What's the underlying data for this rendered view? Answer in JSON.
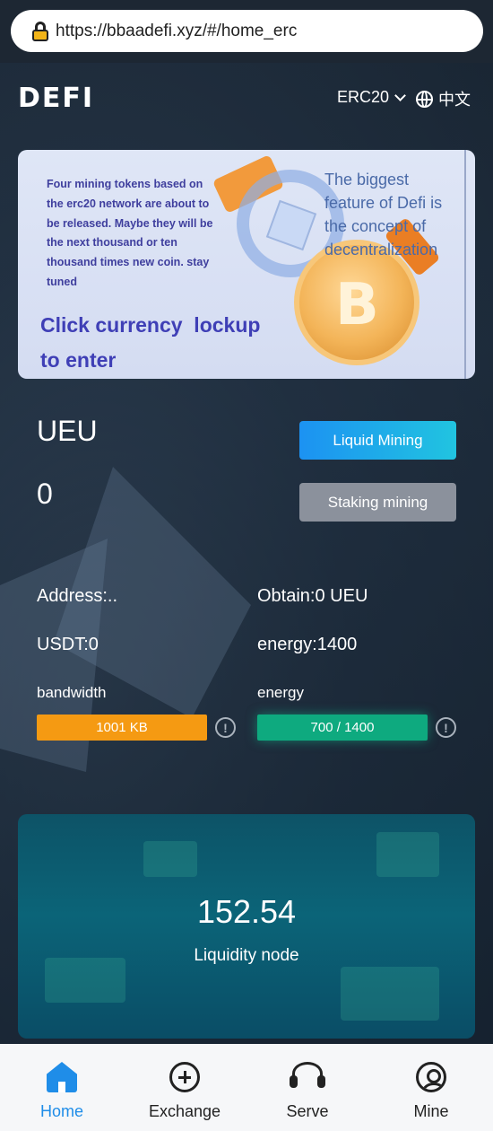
{
  "browser": {
    "url": "https://bbaadefi.xyz/#/home_erc"
  },
  "header": {
    "logo": "DEFI",
    "network": "ERC20",
    "language": "中文"
  },
  "banner": {
    "text": "Four mining tokens based on the erc20 network are about to be released. Maybe they will be the next thousand or ten thousand times new coin. stay tuned",
    "cta_line1": "Click currency  lockup",
    "cta_line2": "to enter",
    "tagline": "The biggest feature of Defi is the concept of decentralization"
  },
  "token": {
    "name": "UEU",
    "amount": "0",
    "liquid_button": "Liquid Mining",
    "staking_button": "Staking mining"
  },
  "account": {
    "address": "Address:..",
    "obtain": "Obtain:0 UEU",
    "usdt": "USDT:0",
    "energy": "energy:1400",
    "bandwidth_label": "bandwidth",
    "energy_label": "energy",
    "bandwidth_bar": "1001 KB",
    "energy_bar": "700 / 1400",
    "bandwidth_color": "#f59a12",
    "energy_color": "#0eaa7f"
  },
  "node": {
    "value": "152.54",
    "label": "Liquidity node"
  },
  "nav": {
    "items": [
      {
        "label": "Home",
        "icon": "home-icon",
        "active": true
      },
      {
        "label": "Exchange",
        "icon": "plus-circle-icon"
      },
      {
        "label": "Serve",
        "icon": "headset-icon"
      },
      {
        "label": "Mine",
        "icon": "user-icon"
      }
    ],
    "active_color": "#1f8de8"
  }
}
